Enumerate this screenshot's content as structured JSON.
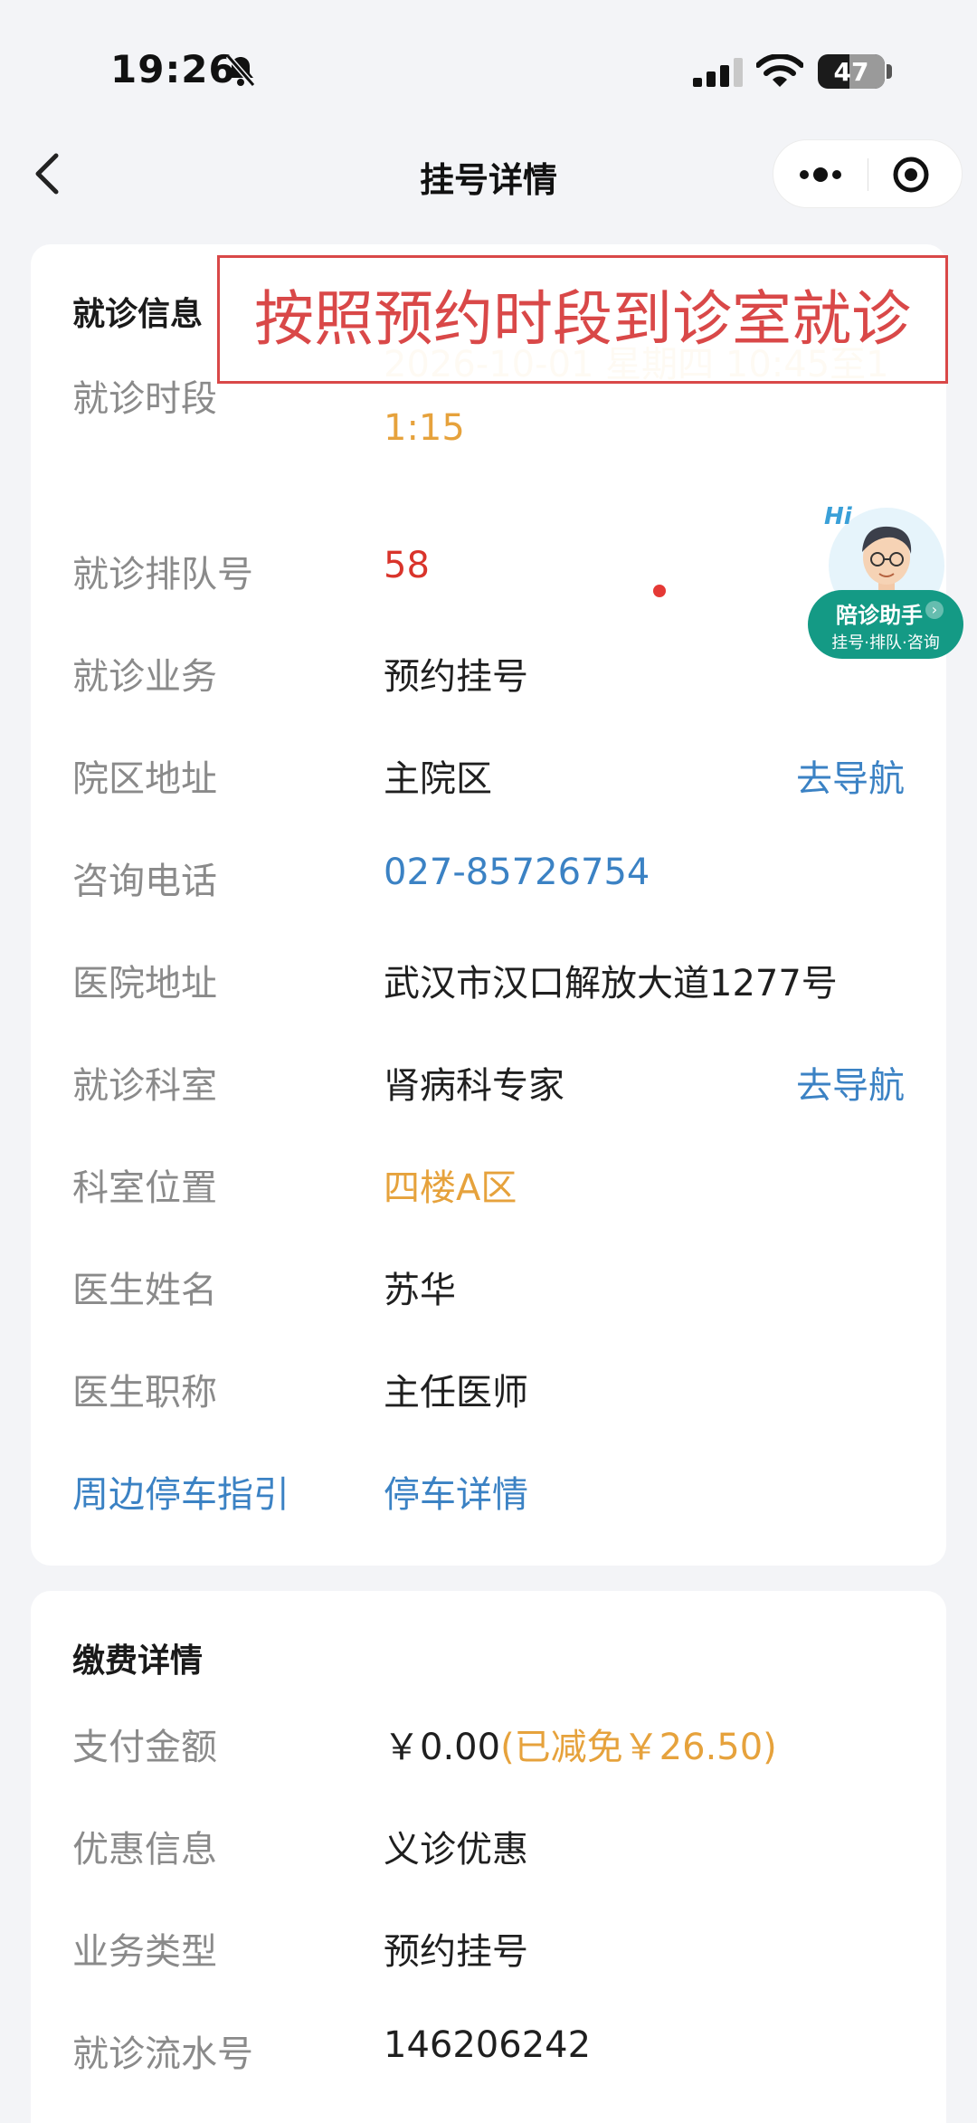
{
  "status_bar": {
    "time": "19:26",
    "battery": "47",
    "battery_level": 0.47
  },
  "nav": {
    "title": "挂号详情"
  },
  "annotation": {
    "text": "按照预约时段到诊室就诊"
  },
  "visit_info": {
    "title": "就诊信息",
    "rows": [
      {
        "label": "就诊时段",
        "value": "2026-10-01 星期四 10:45至11:15"
      },
      {
        "label": "就诊排队号",
        "value": "58"
      },
      {
        "label": "就诊业务",
        "value": "预约挂号"
      },
      {
        "label": "院区地址",
        "value": "主院区",
        "action": "去导航"
      },
      {
        "label": "咨询电话",
        "value": "027-85726754"
      },
      {
        "label": "医院地址",
        "value": "武汉市汉口解放大道1277号"
      },
      {
        "label": "就诊科室",
        "value": "肾病科专家",
        "action": "去导航"
      },
      {
        "label": "科室位置",
        "value": "四楼A区"
      },
      {
        "label": "医生姓名",
        "value": "苏华"
      },
      {
        "label": "医生职称",
        "value": "主任医师"
      },
      {
        "label": "周边停车指引",
        "value": "停车详情"
      }
    ]
  },
  "payment": {
    "title": "缴费详情",
    "rows": [
      {
        "label": "支付金额",
        "value": "￥0.00",
        "note": "(已减免￥26.50)"
      },
      {
        "label": "优惠信息",
        "value": "义诊优惠"
      },
      {
        "label": "业务类型",
        "value": "预约挂号"
      },
      {
        "label": "就诊流水号",
        "value": "146206242"
      }
    ]
  },
  "assistant": {
    "hi": "Hi",
    "title": "陪诊助手",
    "subtitle": "挂号·排队·咨询"
  },
  "colors": {
    "orange": "#e6a23c",
    "red": "#d9342b",
    "link_blue": "#3b82c4",
    "assistant_green": "#149a85",
    "annotation_red": "#d94848"
  }
}
